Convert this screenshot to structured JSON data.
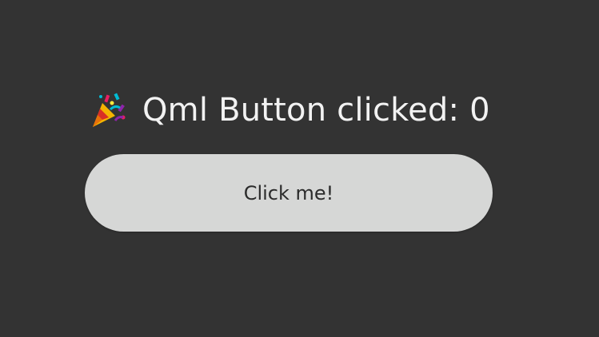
{
  "status": {
    "icon": "party-popper-icon",
    "label": "Qml Button clicked: 0"
  },
  "button": {
    "label": "Click me!"
  },
  "colors": {
    "background": "#333333",
    "button": "#d6d7d6",
    "text": "#f2f2f2"
  }
}
